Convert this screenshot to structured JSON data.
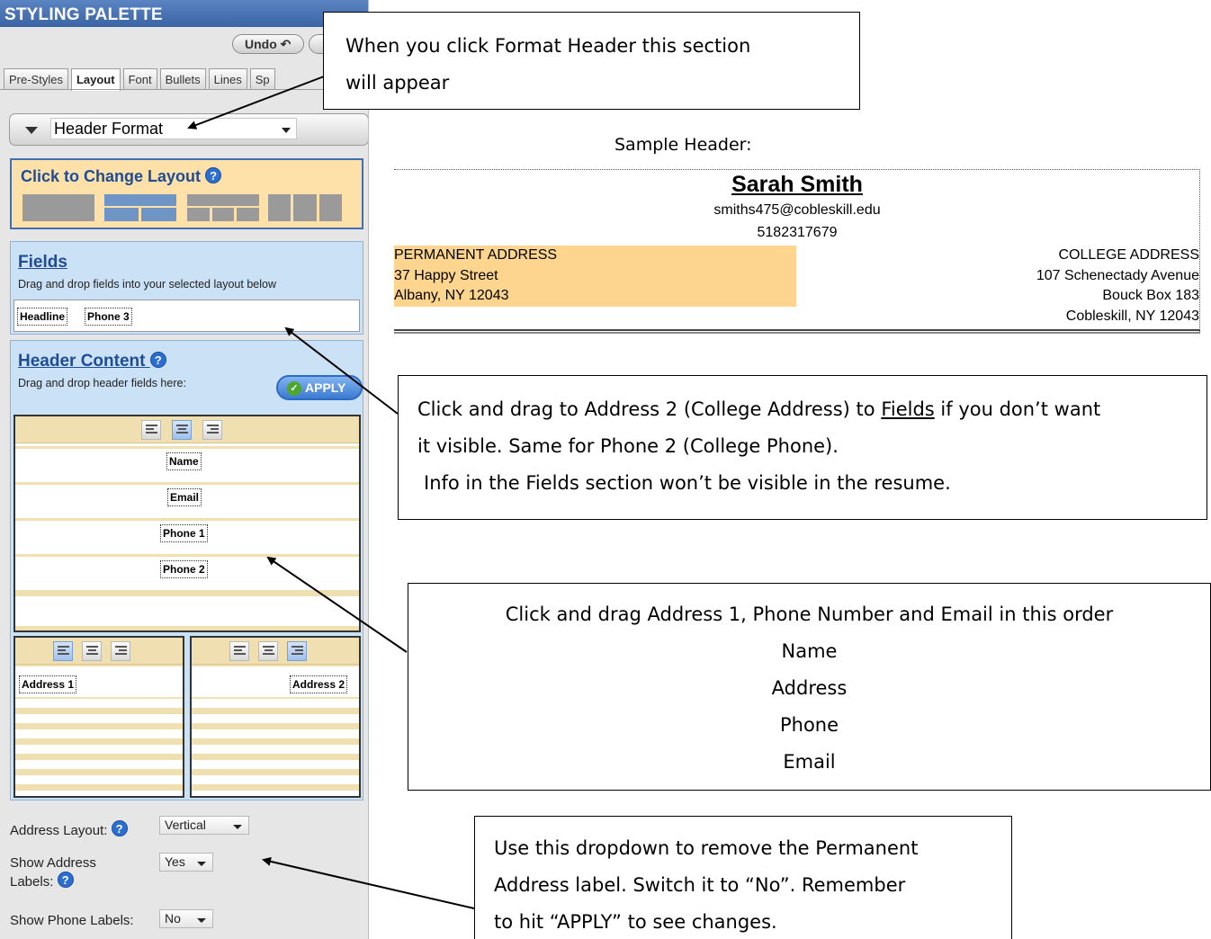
{
  "palette": {
    "title": "STYLING PALETTE",
    "undo_label": "Undo",
    "tabs": [
      "Pre-Styles",
      "Layout",
      "Font",
      "Bullets",
      "Lines",
      "Sp"
    ],
    "active_tab": "Layout",
    "section_select": "Header Format",
    "layout": {
      "title": "Click to Change Layout"
    },
    "fields": {
      "title": "Fields",
      "subtitle": "Drag and drop fields into your selected layout below",
      "chips": [
        "Headline",
        "Phone 3"
      ]
    },
    "header_content": {
      "title": "Header Content",
      "subtitle": "Drag and drop header fields here:",
      "apply_label": "APPLY",
      "main_fields": [
        "Name",
        "Email",
        "Phone 1",
        "Phone 2"
      ],
      "left_field": "Address 1",
      "right_field": "Address 2"
    },
    "options": {
      "address_layout_label": "Address Layout:",
      "address_layout_value": "Vertical",
      "show_address_labels_label_1": "Show Address",
      "show_address_labels_label_2": "Labels:",
      "show_address_labels_value": "Yes",
      "show_phone_labels_label": "Show Phone Labels:",
      "show_phone_labels_value": "No"
    }
  },
  "callouts": {
    "format_header": [
      "When you click Format Header this section",
      "will appear"
    ],
    "fields_note": {
      "line1_pre": "Click and drag to Address 2 (College Address) to ",
      "line1_link": "Fields",
      "line1_post": " if you don’t want",
      "line2": "it visible. Same for Phone 2 (College Phone).",
      "line3": "Info in the Fields section won’t be visible in the resume."
    },
    "order_note": [
      "Click and drag Address 1, Phone Number and Email in this order",
      "Name",
      "Address",
      "Phone",
      "Email"
    ],
    "dropdown_note": [
      "Use this dropdown to remove the Permanent",
      "Address label.  Switch it to “No”.  Remember",
      "to hit “APPLY” to see changes."
    ]
  },
  "sample": {
    "label": "Sample Header:",
    "name": "Sarah Smith",
    "email": "smiths475@cobleskill.edu",
    "phone": "5182317679",
    "permanent": [
      "PERMANENT ADDRESS",
      "37 Happy Street",
      "Albany, NY 12043"
    ],
    "college": [
      "COLLEGE ADDRESS",
      "107 Schenectady Avenue",
      "Bouck Box 183",
      "Cobleskill, NY 12043"
    ]
  },
  "colors": {
    "palette_title_bg": "#3b64a6",
    "panel_blue": "#cbe1f6",
    "layout_orange": "#fde1a9",
    "address_highlight": "#fdd58f",
    "heading_blue": "#1f4c97"
  }
}
